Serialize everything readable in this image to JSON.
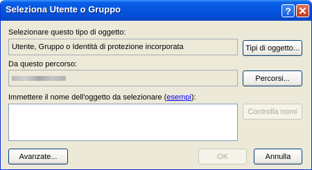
{
  "window": {
    "title": "Seleziona Utente o Gruppo"
  },
  "titlebar": {
    "help_glyph": "?",
    "close_glyph": "✕"
  },
  "object_type": {
    "label": "Selezionare questo tipo di oggetto:",
    "value": "Utente, Gruppo o Identità di protezione incorporata",
    "button": "Tipi di oggetto..."
  },
  "location": {
    "label": "Da questo percorso:",
    "button": "Percorsi..."
  },
  "names": {
    "label_prefix": "Immettere il nome dell'oggetto da selezionare (",
    "link": "esempi",
    "label_suffix": "):",
    "value": "",
    "check_button": "Controlla nomi"
  },
  "footer": {
    "advanced_button": "Avanzate...",
    "ok_button": "OK",
    "cancel_button": "Annulla"
  }
}
